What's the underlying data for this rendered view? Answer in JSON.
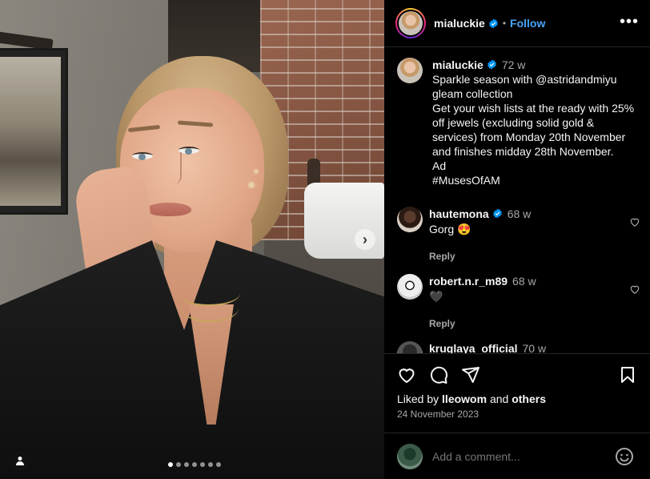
{
  "post": {
    "author": "mialuckie",
    "follow_label": "Follow",
    "separator": "•",
    "more_label": "•••",
    "verified_color": "#0095f6",
    "accent_color": "#4aa3f5",
    "carousel": {
      "total_slides": 7,
      "active_index": 0
    }
  },
  "caption": {
    "username": "mialuckie",
    "time": "72 w",
    "lines": [
      "Sparkle season with @astridandmiyu",
      "gleam collection",
      "Get your wish lists at the ready with 25%",
      "off jewels (excluding solid gold &",
      "services) from Monday 20th November",
      "and finishes midday 28th November.",
      "Ad",
      "#MusesOfAM"
    ]
  },
  "comments": [
    {
      "username": "hautemona",
      "verified": true,
      "time": "68 w",
      "text": "Gorg 😍",
      "reply": "Reply"
    },
    {
      "username": "robert.n.r_m89",
      "verified": false,
      "time": "68 w",
      "text": "🖤",
      "reply": "Reply"
    },
    {
      "username": "kruglaya_official",
      "verified": false,
      "time": "70 w",
      "text": "",
      "reply": ""
    }
  ],
  "footer": {
    "liked_by_prefix": "Liked by",
    "liked_by_user": "lleowom",
    "liked_by_join": "and",
    "liked_by_suffix": "others",
    "date": "24 November 2023",
    "add_comment_placeholder": "Add a comment..."
  },
  "icons": [
    "heart-icon",
    "comment-icon",
    "share-icon",
    "bookmark-icon",
    "emoji-icon",
    "more-icon",
    "user-tag-icon",
    "next-arrow-icon"
  ]
}
